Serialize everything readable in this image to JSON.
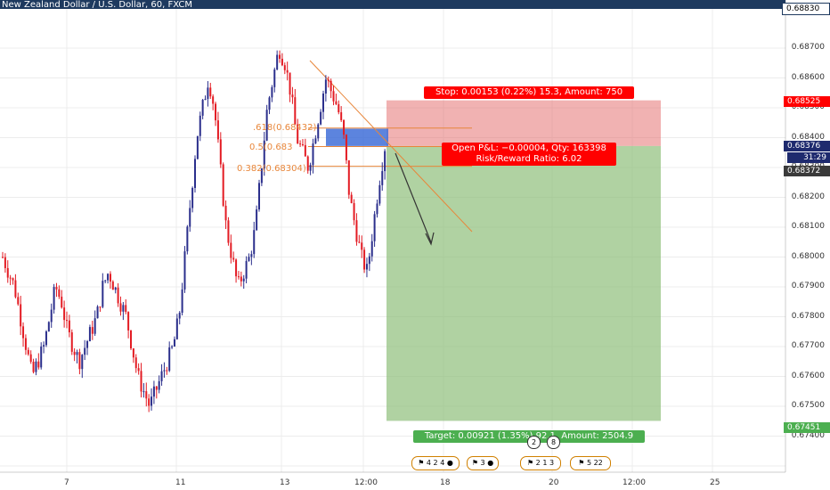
{
  "header": {
    "title": "New Zealand Dollar / U.S. Dollar, 60, FXCM"
  },
  "price_axis": {
    "ticks": [
      "0.68700",
      "0.68600",
      "0.68500",
      "0.68400",
      "0.68300",
      "0.68200",
      "0.68100",
      "0.68000",
      "0.67900",
      "0.67800",
      "0.67700",
      "0.67600",
      "0.67500",
      "0.67400"
    ],
    "labels": {
      "top": "0.68830",
      "stop": "0.68525",
      "current": "0.68376",
      "countdown": "31:29",
      "entry": "0.68372",
      "target": "0.67451"
    },
    "colors": {
      "top": "#1e3a5f",
      "stop": "#ff0000",
      "current": "#1e2a6e",
      "entry": "#3a3a3a",
      "target": "#4caf50"
    }
  },
  "time_axis": {
    "ticks": [
      "7",
      "11",
      "13",
      "12:00",
      "18",
      "20",
      "12:00",
      "25"
    ]
  },
  "position_tool": {
    "stop_label": "Stop: 0.00153 (0.22%) 15.3, Amount: 750",
    "pnl_label_1": "Open P&L: −0.00004, Qty: 163398",
    "pnl_label_2": "Risk/Reward Ratio: 6.02",
    "target_label": "Target: 0.00921 (1.35%) 92.1, Amount: 2504.9"
  },
  "fib": {
    "l1": ".618(0.68432)",
    "l2": "0.5(0.683",
    "l3": "0.382(0.68304)"
  },
  "events": {
    "e1a": "4",
    "e1b": "2",
    "e1c": "4",
    "e2": "3",
    "e3a": "2",
    "e3b": "1",
    "e3c": "3",
    "e4a": "5",
    "e4b": "22",
    "s1": "2",
    "s2": "8"
  },
  "chart_data": {
    "type": "candlestick",
    "ylim": [
      0.6734,
      0.6884
    ],
    "current_price": 0.68376,
    "entry": 0.68372,
    "stop": 0.68525,
    "target": 0.67451,
    "close_path": [
      0.68,
      0.6795,
      0.679,
      0.678,
      0.677,
      0.676,
      0.6765,
      0.677,
      0.678,
      0.679,
      0.6785,
      0.6775,
      0.677,
      0.6765,
      0.677,
      0.6775,
      0.678,
      0.679,
      0.6795,
      0.679,
      0.6785,
      0.678,
      0.677,
      0.676,
      0.6755,
      0.675,
      0.6755,
      0.676,
      0.6765,
      0.677,
      0.678,
      0.68,
      0.682,
      0.684,
      0.685,
      0.686,
      0.685,
      0.683,
      0.681,
      0.68,
      0.679,
      0.6795,
      0.68,
      0.681,
      0.683,
      0.685,
      0.686,
      0.687,
      0.6865,
      0.6855,
      0.684,
      0.6835,
      0.683,
      0.684,
      0.685,
      0.686,
      0.6855,
      0.685,
      0.684,
      0.682,
      0.681,
      0.68,
      0.6795,
      0.681,
      0.6825,
      0.6837
    ],
    "colors": {
      "up": "#2b2f8c",
      "down": "#e31b23"
    }
  }
}
